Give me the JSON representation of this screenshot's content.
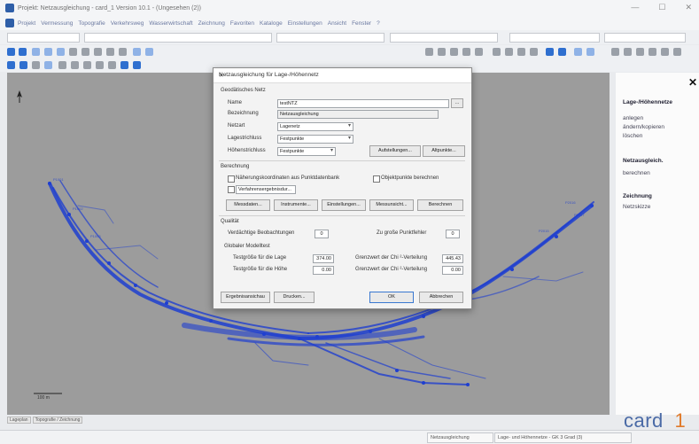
{
  "window": {
    "title": "Projekt: Netzausgleichung - card_1 Version 10.1 - (Ungesehen (2))",
    "controls": [
      "—",
      "☐",
      "✕"
    ]
  },
  "menu": [
    "Projekt",
    "Vermessung",
    "Topografie",
    "Verkehrsweg",
    "Wasserwirtschaft",
    "Zeichnung",
    "Favoriten",
    "Kataloge",
    "Einstellungen",
    "Ansicht",
    "Fenster",
    "?"
  ],
  "dialog": {
    "title": "Netzausgleichung für Lage-/Höhennetz",
    "close": "✕",
    "section_net": "Geodätisches Netz",
    "labels": {
      "name": "Name",
      "desc": "Bezeichnung",
      "type": "Netzart",
      "lage": "Lagestrichluss",
      "hoehe": "Höhenstrichluss"
    },
    "values": {
      "name": "testNTZ",
      "desc": "Netzausgleichung",
      "type": "Lagenetz",
      "lage": "Festpunkte",
      "hoehe": "Festpunkte"
    },
    "btn_ellipsis": "...",
    "btn_aufstellungen": "Aufstellungen...",
    "btn_altpunkte": "Altpunkte...",
    "section_calc": "Berechnung",
    "chk_naeherung": "Näherungskoordinaten aus Punktdatenbank",
    "chk_objekt": "Objektpunkte berechnen",
    "chk_verfahren": "Verfahrensergebnisdur...",
    "calc_buttons": [
      "Messdaten...",
      "Instrumente...",
      "Einstellungen...",
      "Messunsicht...",
      "Berechnen"
    ],
    "section_quality": "Qualität",
    "verdaechtig_label": "Verdächtige Beobachtungen",
    "verdaechtig_val": "0",
    "grosse_label": "Zu große Punktfehler",
    "grosse_val": "0",
    "globaler": "Globaler Modelltest",
    "tg_lage": "Testgröße für die Lage",
    "tg_lage_val": "374.00",
    "tg_hoehe": "Testgröße für die Höhe",
    "tg_hoehe_val": "0.00",
    "grenz_lage": "Grenzwert der Chi ²-Verteilung",
    "grenz_lage_val": "445.43",
    "grenz_hoehe": "Grenzwert der Chi ²-Verteilung",
    "grenz_hoehe_val": "0.00",
    "btn_ergebnis": "Ergebnisansichau",
    "btn_drucken": "Drucken...",
    "btn_ok": "OK",
    "btn_abbrechen": "Abbrechen"
  },
  "right_panel": {
    "head1": "Lage-/Höhennetze",
    "items1": [
      "anlegen",
      "ändern/kopieren",
      "löschen"
    ],
    "head2": "Netzausgleich.",
    "items2": [
      "berechnen"
    ],
    "head3": "Zeichnung",
    "items3": [
      "Netzskizze"
    ]
  },
  "logo": {
    "text": "card",
    "suffix": "_1"
  },
  "bottom_tabs": [
    "Lageplan",
    "Topografie / Zeichnung"
  ],
  "status": {
    "left": "Netzausgleichung",
    "right": "Lage- und Höhennetze - GK 3 Grad (3)"
  },
  "scale": "100 m",
  "colors": {
    "network_blue": "#1f3fd0",
    "canvas_gray": "#9c9c9c"
  }
}
